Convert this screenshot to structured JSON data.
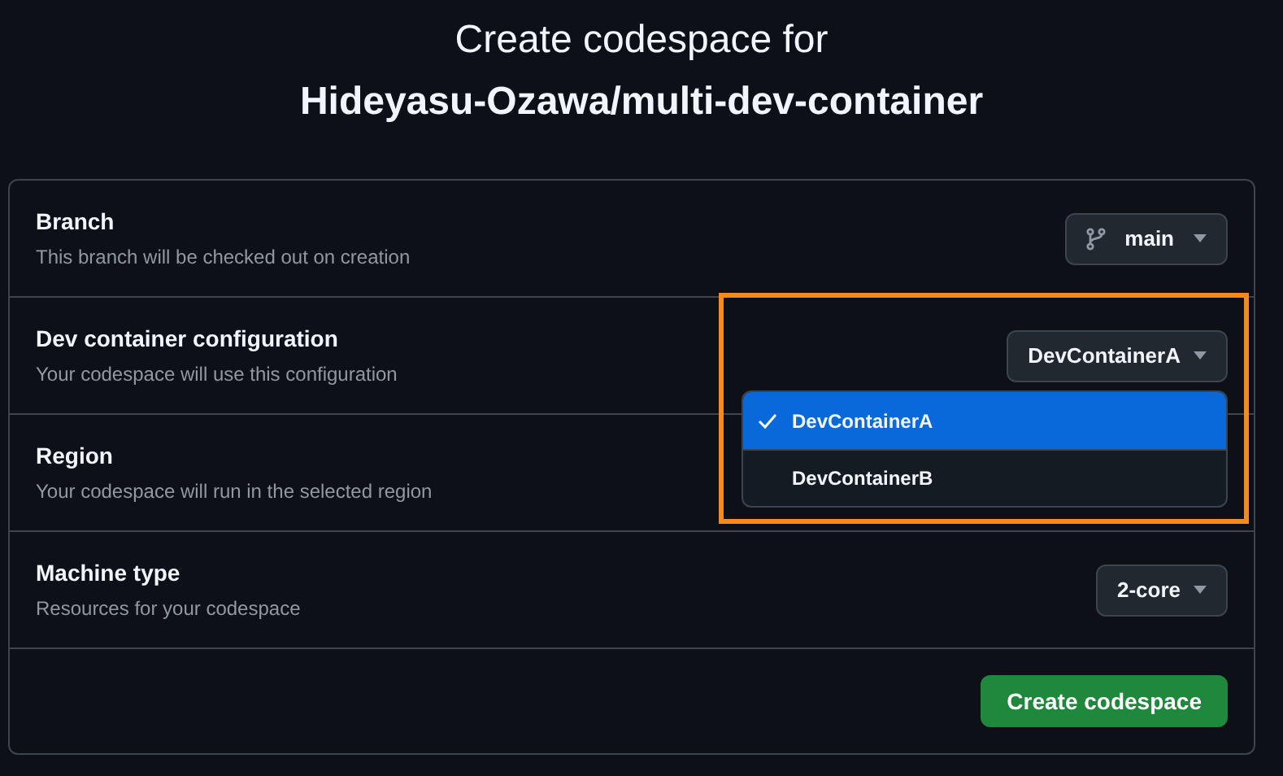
{
  "heading": {
    "line1": "Create codespace for",
    "line2": "Hideyasu-Ozawa/multi-dev-container"
  },
  "rows": [
    {
      "title": "Branch",
      "subtitle": "This branch will be checked out on creation",
      "control": {
        "kind": "branch",
        "label": "main"
      }
    },
    {
      "title": "Dev container configuration",
      "subtitle": "Your codespace will use this configuration",
      "control": {
        "kind": "select",
        "label": "DevContainerA"
      },
      "menu": [
        {
          "label": "DevContainerA",
          "selected": true
        },
        {
          "label": "DevContainerB",
          "selected": false
        }
      ]
    },
    {
      "title": "Region",
      "subtitle": "Your codespace will run in the selected region"
    },
    {
      "title": "Machine type",
      "subtitle": "Resources for your codespace",
      "control": {
        "kind": "select",
        "label": "2-core"
      }
    }
  ],
  "highlight": {
    "color": "#f58a1f"
  },
  "submit": "Create codespace"
}
